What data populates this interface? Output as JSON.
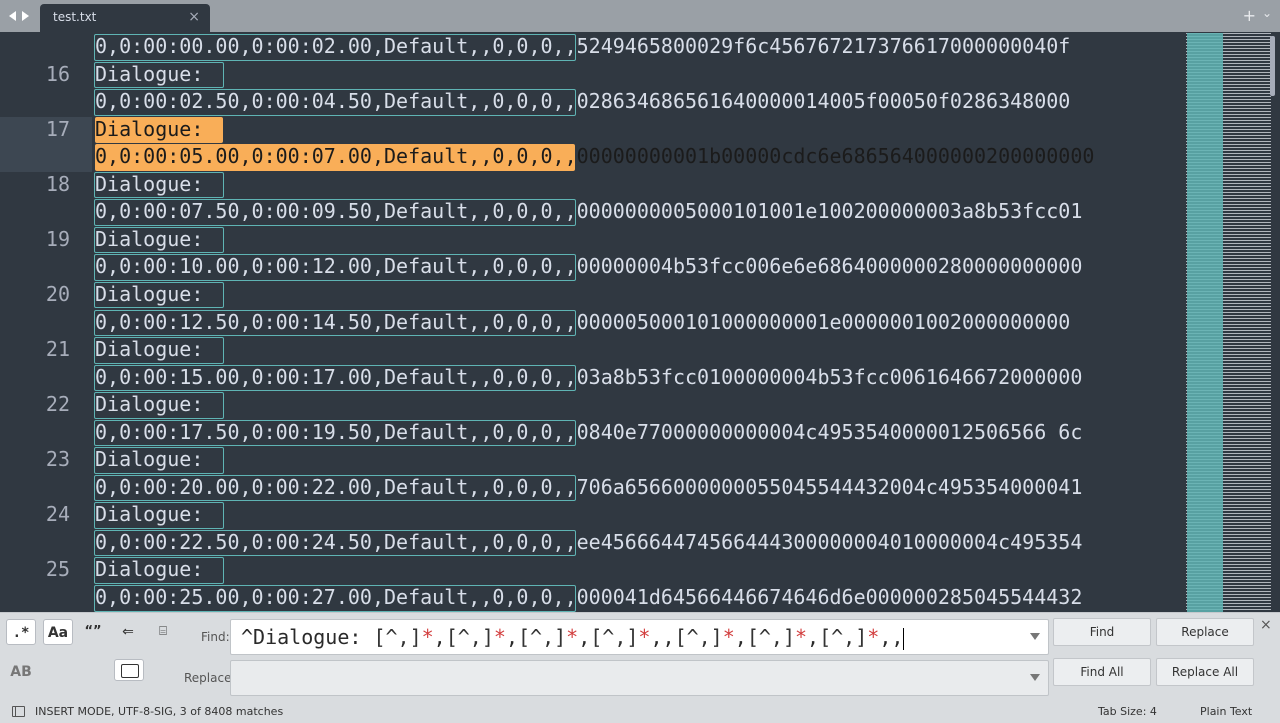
{
  "tab": {
    "title": "test.txt",
    "close_glyph": "×",
    "new_tab_glyph": "+",
    "overflow_glyph": "⌄"
  },
  "editor": {
    "rows": [
      {
        "ln": "",
        "text": "0,0:00:00.00,0:00:02.00,Default,,0,0,0,,5249465800029f6c456767217376617000000040f"
      },
      {
        "ln": "16",
        "text": "Dialogue:"
      },
      {
        "ln": "",
        "text": "0,0:00:02.50,0:00:04.50,Default,,0,0,0,,028634686561640000014005f00050f0286348000"
      },
      {
        "ln": "17",
        "text": "Dialogue:"
      },
      {
        "ln": "",
        "text": "0,0:00:05.00,0:00:07.00,Default,,0,0,0,,00000000001b00000cdc6e686564000000200000000"
      },
      {
        "ln": "18",
        "text": "Dialogue:"
      },
      {
        "ln": "",
        "text": "0,0:00:07.50,0:00:09.50,Default,,0,0,0,,0000000005000101001e100200000003a8b53fcc01"
      },
      {
        "ln": "19",
        "text": "Dialogue:"
      },
      {
        "ln": "",
        "text": "0,0:00:10.00,0:00:12.00,Default,,0,0,0,,00000004b53fcc006e6e6864000000280000000000"
      },
      {
        "ln": "20",
        "text": "Dialogue:"
      },
      {
        "ln": "",
        "text": "0,0:00:12.50,0:00:14.50,Default,,0,0,0,,000005000101000000001e0000001002000000000"
      },
      {
        "ln": "21",
        "text": "Dialogue:"
      },
      {
        "ln": "",
        "text": "0,0:00:15.00,0:00:17.00,Default,,0,0,0,,03a8b53fcc0100000004b53fcc0061646672000000"
      },
      {
        "ln": "22",
        "text": "Dialogue:"
      },
      {
        "ln": "",
        "text": "0,0:00:17.50,0:00:19.50,Default,,0,0,0,,0840e77000000000004c4953540000012506566 6c"
      },
      {
        "ln": "23",
        "text": "Dialogue:"
      },
      {
        "ln": "",
        "text": "0,0:00:20.00,0:00:22.00,Default,,0,0,0,,706a6566000000055045544432004c495354000041"
      },
      {
        "ln": "24",
        "text": "Dialogue:"
      },
      {
        "ln": "",
        "text": "0,0:00:22.50,0:00:24.50,Default,,0,0,0,,ee456664474566444300000004010000004c495354"
      },
      {
        "ln": "25",
        "text": "Dialogue:"
      },
      {
        "ln": "",
        "text": "0,0:00:25.00,0:00:27.00,Default,,0,0,0,,000041d64566446674646d6e000000285045544432"
      }
    ],
    "selected_line": "17"
  },
  "find_panel": {
    "find_label": "Find:",
    "replace_label": "Replace:",
    "find_query_parts": [
      "^Dialogue: ",
      "[^,]",
      "*",
      ",",
      "[^,]",
      "*",
      ",",
      "[^,]",
      "*",
      ",",
      "[^,]",
      "*",
      ",,",
      "[^,]",
      "*",
      ",",
      "[^,]",
      "*",
      ",",
      "[^,]",
      "*",
      ",,"
    ],
    "replace_value": "",
    "options": {
      "regex": ".*",
      "case": "Aa",
      "whole_word": "“”",
      "wrap": "⇐",
      "in_selection": "⌸",
      "preserve_case": "AB"
    },
    "buttons": {
      "find": "Find",
      "replace": "Replace",
      "find_all": "Find All",
      "replace_all": "Replace All"
    },
    "close_glyph": "×"
  },
  "status": {
    "text": "INSERT MODE, UTF-8-SIG, 3 of 8408 matches",
    "tab_size": "Tab Size: 4",
    "syntax": "Plain Text"
  },
  "colors": {
    "editor_bg": "#303841",
    "match_outline": "#5fb4b4",
    "selection": "#f9ae58",
    "regex_star": "#d23d3d"
  }
}
